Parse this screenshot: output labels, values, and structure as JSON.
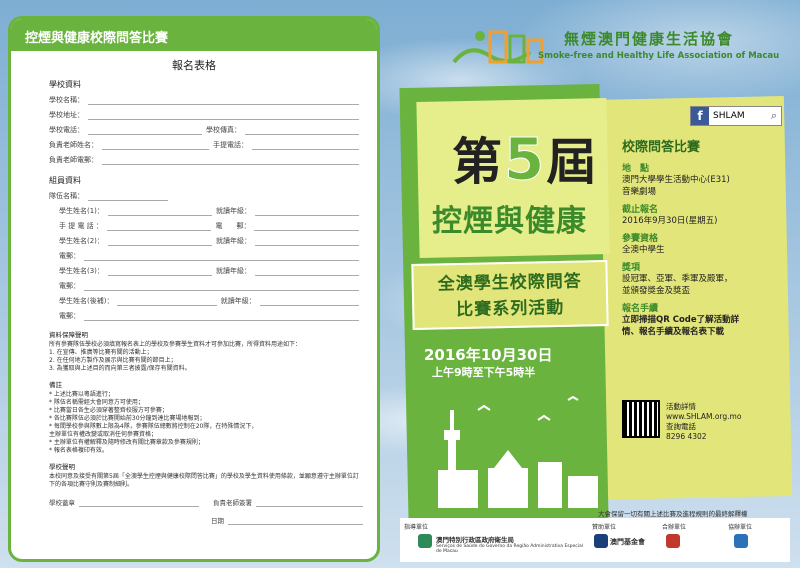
{
  "form": {
    "header": "控煙與健康校際問答比賽",
    "title": "報名表格",
    "school_section": "學校資料",
    "school_name": "學校名稱：",
    "school_address": "學校地址：",
    "school_phone": "學校電話：",
    "school_fax": "學校傳真：",
    "teacher_name": "負責老師姓名：",
    "mobile": "手提電話：",
    "teacher_email": "負責老師電郵：",
    "team_section": "組員資料",
    "team_name": "隊伍名稱：",
    "student1": "學生姓名(1)：",
    "student2": "學生姓名(2)：",
    "student3": "學生姓名(3)：",
    "student_reserve": "學生姓名(後補)：",
    "grade": "就讀年級：",
    "phone": "手 提 電 話 ：",
    "email_short": "電　　郵：",
    "email": "電郵：",
    "privacy_title": "資料保障聲明",
    "privacy_text": "所有參賽隊伍學校必須填寫報名表上的學校及參賽學生資料才可參加比賽，所得資料用途如下：\n1. 在宣傳、推廣等比賽有關的活動上；\n2. 在任何地方製作及展示與比賽有關的節目上；\n3. 為獲取與上述目的而向第三者披露/保存有關資料。",
    "notes_title": "備註",
    "notes_text": "* 上述比賽以粵語進行；\n* 隊伍名稱需經大會同意方可使用；\n* 比賽當日各生必須穿著整齊校服方可參賽；\n* 各比賽隊伍必須於比賽開始前30分鐘到達比賽場地報到；\n* 每間學校參與隊數上限為4隊，參賽隊伍總數將控制在20隊，在特殊情況下，\n  主辦單位有權改變或取消任何參賽資格；\n* 主辦單位有權解釋及隨時修改有關比賽章款及參賽規則；\n* 報名表格複印有效。",
    "decl_title": "學校聲明",
    "decl_text": "本校同意及接受有關第5屆「全澳學生控煙與健康校際問答比賽」的學校及學生資料使用條款，並願意遵守主辦單位訂下的各項比賽守則及賽制細則。",
    "school_stamp": "學校蓋章",
    "teacher_sign": "負責老師簽署",
    "date_label": "日期",
    "date_sep": "/"
  },
  "org": {
    "name_zh": "無煙澳門健康生活協會",
    "name_en": "Smoke-free and Healthy Life Association of Macau"
  },
  "poster": {
    "edition_pre": "第",
    "edition_num": "5",
    "edition_post": "屆",
    "subtitle": "控煙與健康",
    "banner_line1": "全澳學生校際問答",
    "banner_line2": "比賽系列活動",
    "date": "2016年10月30日",
    "time": "上午9時至下午5時半"
  },
  "social": {
    "label": "SHLAM"
  },
  "info": {
    "heading": "校際問答比賽",
    "venue_key": "地　點",
    "venue_val": "澳門大學學生活動中心(E31)\n音樂劇場",
    "deadline_key": "截止報名",
    "deadline_val": "2016年9月30日(星期五)",
    "eligibility_key": "參賽資格",
    "eligibility_val": "全澳中學生",
    "prize_key": "獎項",
    "prize_val": "設冠軍、亞軍、季軍及殿軍，\n並頒發獎金及獎盃",
    "signup_key": "報名手續",
    "signup_val": "立即掃描QR Code了解活動詳\n情、報名手續及報名表下載",
    "qr_line1": "活動詳情",
    "qr_line2": "www.SHLAM.org.mo",
    "qr_line3": "查詢電話",
    "qr_line4": "8296 4302"
  },
  "footnote": "大會保留一切有關上述比賽及進程規則的最終解釋權",
  "sponsors": {
    "label1": "指導單位",
    "label2": "贊助單位",
    "label3": "合辦單位",
    "label4": "協辦單位",
    "health_zh": "澳門特別行政區政府衛生局",
    "health_pt": "Serviços de Saúde do Governo da Região Administrativa Especial de Macau",
    "foundation": "澳門基金會"
  },
  "colors": {
    "green": "#6ab33e",
    "dark_green": "#3c8a2b",
    "yellow": "#e2e67a"
  }
}
